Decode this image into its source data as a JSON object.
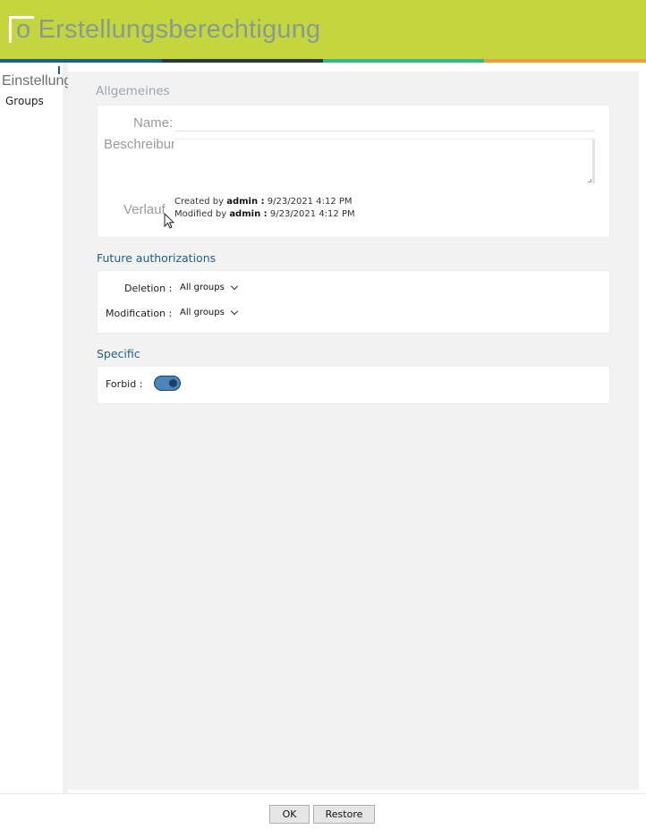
{
  "header": {
    "title": "Erstellungsberechtigung",
    "title_prefix": "o"
  },
  "colors": {
    "header_bg": "#c3d63e",
    "accent_blue": "#1f5f86",
    "stripe": [
      "#1f5f86",
      "#2c3a3a",
      "#35b889",
      "#e8a23d"
    ]
  },
  "sidebar": {
    "heading": "Einstellungen",
    "items": [
      {
        "label": "Groups"
      }
    ]
  },
  "general": {
    "title": "Allgemeines",
    "name_label": "Name:",
    "name_value": "",
    "description_label": "Beschreibung:",
    "description_value": "",
    "history_label": "Verlauf",
    "created_prefix": "Created by",
    "created_user": "admin :",
    "created_date": "9/23/2021 4:12 PM",
    "modified_prefix": "Modified by",
    "modified_user": "admin :",
    "modified_date": "9/23/2021 4:12 PM"
  },
  "future": {
    "title": "Future authorizations",
    "deletion_label": "Deletion :",
    "deletion_value": "All groups",
    "modification_label": "Modification :",
    "modification_value": "All groups"
  },
  "specific": {
    "title": "Specific",
    "forbid_label": "Forbid :",
    "forbid_on": true
  },
  "footer": {
    "ok_label": "OK",
    "restore_label": "Restore"
  }
}
